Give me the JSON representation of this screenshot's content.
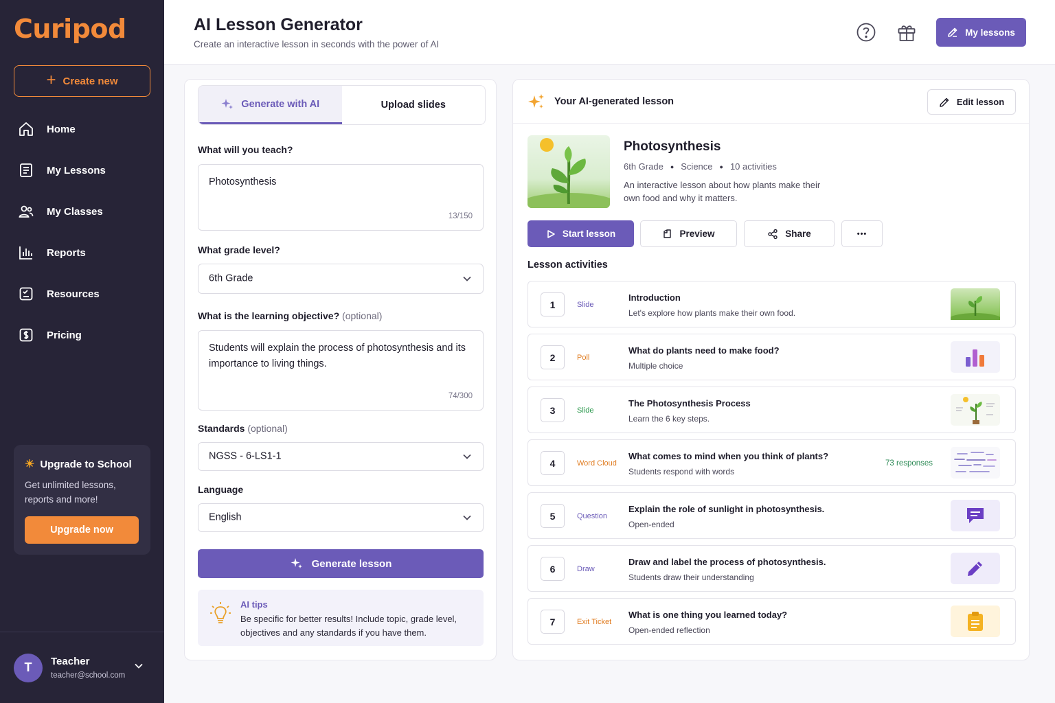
{
  "app": {
    "logo": "Curipod"
  },
  "sidebar": {
    "create_label": "Create new",
    "items": [
      {
        "label": "Home",
        "icon": "home-icon"
      },
      {
        "label": "My Lessons",
        "icon": "lessons-icon"
      },
      {
        "label": "My Classes",
        "icon": "classes-icon"
      },
      {
        "label": "Reports",
        "icon": "reports-icon"
      },
      {
        "label": "Resources",
        "icon": "resources-icon"
      },
      {
        "label": "Pricing",
        "icon": "pricing-icon"
      }
    ],
    "upgrade": {
      "title": "Upgrade to School",
      "subtitle": "Get unlimited lessons, reports and more!",
      "button": "Upgrade now"
    },
    "user": {
      "initial": "T",
      "name": "Teacher",
      "email": "teacher@school.com"
    }
  },
  "header": {
    "title": "AI Lesson Generator",
    "subtitle": "Create an interactive lesson in seconds with the power of AI",
    "my_lessons_label": "My lessons"
  },
  "form": {
    "tabs": [
      {
        "label": "Generate with AI",
        "active": true
      },
      {
        "label": "Upload slides",
        "active": false
      }
    ],
    "topic": {
      "label": "What will you teach?",
      "value": "Photosynthesis",
      "count": "13/150"
    },
    "grade": {
      "label": "What grade level?",
      "value": "6th Grade"
    },
    "objective": {
      "label": "What is the learning objective?",
      "optional": "(optional)",
      "value": "Students will explain the process of photosynthesis and its importance to living things.",
      "count": "74/300"
    },
    "standards": {
      "label": "Standards",
      "optional": "(optional)",
      "value": "NGSS - 6-LS1-1"
    },
    "language": {
      "label": "Language",
      "value": "English"
    },
    "generate_label": "Generate lesson",
    "tips": {
      "title": "AI tips",
      "text": "Be specific for better results! Include topic, grade level, objectives and any standards if you have them."
    }
  },
  "lesson": {
    "header_title": "Your AI-generated lesson",
    "edit_label": "Edit lesson",
    "name": "Photosynthesis",
    "grade": "6th Grade",
    "subject": "Science",
    "activities_count": "10 activities",
    "description": "An interactive lesson about how plants make their own food and why it matters.",
    "buttons": {
      "start": "Start lesson",
      "preview": "Preview",
      "share": "Share",
      "more": "•••"
    },
    "activities_label": "Lesson activities",
    "activities": [
      {
        "num": "1",
        "type": "Slide",
        "type_color": "#6b5bb8",
        "title": "Introduction",
        "sub": "Let's explore how plants make their own food.",
        "thumb": "plant-sprout-image",
        "responses": ""
      },
      {
        "num": "2",
        "type": "Poll",
        "type_color": "#e07b1f",
        "title": "What do plants need to make food?",
        "sub": "Multiple choice",
        "thumb": "bar-chart-icon",
        "responses": ""
      },
      {
        "num": "3",
        "type": "Slide",
        "type_color": "#2e9a4f",
        "title": "The Photosynthesis Process",
        "sub": "Learn the 6 key steps.",
        "thumb": "plant-diagram-image",
        "responses": ""
      },
      {
        "num": "4",
        "type": "Word Cloud",
        "type_color": "#e07b1f",
        "title": "What comes to mind when you think of plants?",
        "sub": "Students respond with words",
        "thumb": "word-cloud-image",
        "responses": "73 responses"
      },
      {
        "num": "5",
        "type": "Question",
        "type_color": "#6b5bb8",
        "title": "Explain the role of sunlight in photosynthesis.",
        "sub": "Open-ended",
        "thumb": "chat-bubble-icon",
        "responses": ""
      },
      {
        "num": "6",
        "type": "Draw",
        "type_color": "#6b5bb8",
        "title": "Draw and label the process of photosynthesis.",
        "sub": "Students draw their understanding",
        "thumb": "pencil-icon",
        "responses": ""
      },
      {
        "num": "7",
        "type": "Exit Ticket",
        "type_color": "#e07b1f",
        "title": "What is one thing you learned today?",
        "sub": "Open-ended reflection",
        "thumb": "clipboard-icon",
        "responses": ""
      }
    ]
  },
  "colors": {
    "accent": "#6b5bb8",
    "brand_orange": "#f28a3a",
    "sidebar_bg": "#272437"
  }
}
